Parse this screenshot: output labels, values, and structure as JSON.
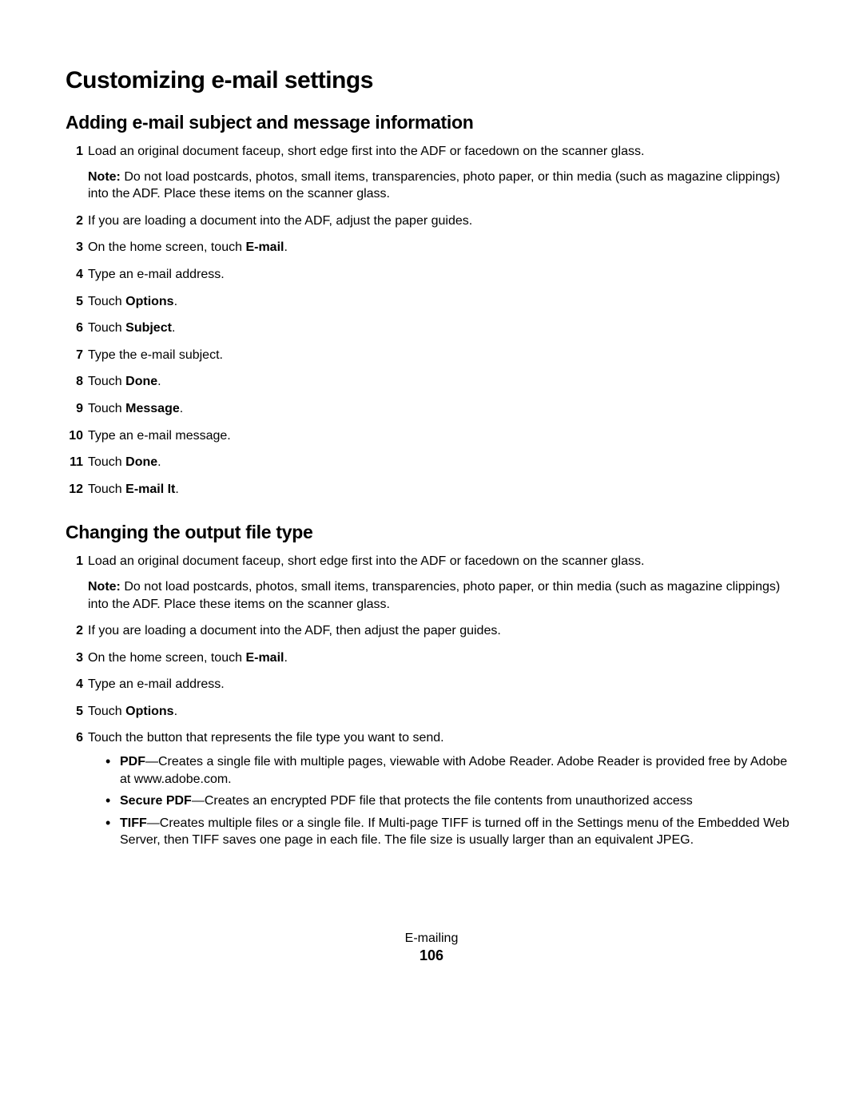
{
  "title": "Customizing e-mail settings",
  "section1": {
    "heading": "Adding e-mail subject and message information",
    "steps": [
      {
        "prefix": "Load an original document faceup, short edge first into the ADF or facedown on the scanner glass.",
        "note_label": "Note: ",
        "note_text": "Do not load postcards, photos, small items, transparencies, photo paper, or thin media (such as magazine clippings) into the ADF. Place these items on the scanner glass."
      },
      {
        "prefix": "If you are loading a document into the ADF, adjust the paper guides."
      },
      {
        "prefix": "On the home screen, touch ",
        "bold": "E-mail",
        "suffix": "."
      },
      {
        "prefix": "Type an e-mail address."
      },
      {
        "prefix": "Touch ",
        "bold": "Options",
        "suffix": "."
      },
      {
        "prefix": "Touch ",
        "bold": "Subject",
        "suffix": "."
      },
      {
        "prefix": "Type the e-mail subject."
      },
      {
        "prefix": "Touch ",
        "bold": "Done",
        "suffix": "."
      },
      {
        "prefix": "Touch ",
        "bold": "Message",
        "suffix": "."
      },
      {
        "prefix": "Type an e-mail message."
      },
      {
        "prefix": "Touch ",
        "bold": "Done",
        "suffix": "."
      },
      {
        "prefix": "Touch ",
        "bold": "E-mail It",
        "suffix": "."
      }
    ]
  },
  "section2": {
    "heading": "Changing the output file type",
    "steps": [
      {
        "prefix": "Load an original document faceup, short edge first into the ADF or facedown on the scanner glass.",
        "note_label": "Note: ",
        "note_text": "Do not load postcards, photos, small items, transparencies, photo paper, or thin media (such as magazine clippings) into the ADF. Place these items on the scanner glass."
      },
      {
        "prefix": "If you are loading a document into the ADF, then adjust the paper guides."
      },
      {
        "prefix": "On the home screen, touch ",
        "bold": "E-mail",
        "suffix": "."
      },
      {
        "prefix": "Type an e-mail address."
      },
      {
        "prefix": "Touch ",
        "bold": "Options",
        "suffix": "."
      },
      {
        "prefix": "Touch the button that represents the file type you want to send.",
        "bullets": [
          {
            "bold": "PDF",
            "text": "—Creates a single file with multiple pages, viewable with Adobe Reader. Adobe Reader is provided free by Adobe at www.adobe.com."
          },
          {
            "bold": "Secure PDF",
            "text": "—Creates an encrypted PDF file that protects the file contents from unauthorized access"
          },
          {
            "bold": "TIFF",
            "text": "—Creates multiple files or a single file. If Multi-page TIFF is turned off in the Settings menu of the Embedded Web Server, then TIFF saves one page in each file. The file size is usually larger than an equivalent JPEG."
          }
        ]
      }
    ]
  },
  "footer": {
    "chapter": "E-mailing",
    "page": "106"
  }
}
